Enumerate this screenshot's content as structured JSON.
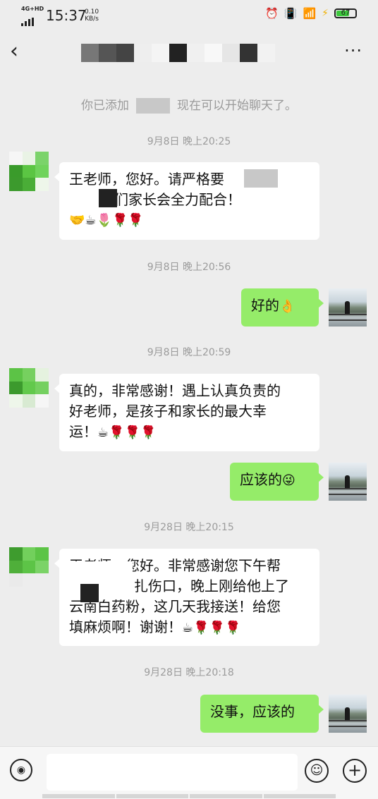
{
  "status_bar": {
    "network": "4G+HD",
    "time": "15:37",
    "speed_value": "0.10",
    "speed_unit": "KB/s",
    "battery": "67",
    "icons": [
      "alarm-icon",
      "vibrate-icon",
      "wifi-icon",
      "charging-icon",
      "battery-icon"
    ]
  },
  "header": {
    "back_icon": "‹",
    "more_icon": "···"
  },
  "system_message": {
    "before": "你已添加",
    "after": "现在可以开始聊天了。"
  },
  "messages": [
    {
      "timestamp": "9月8日 晚上20:25",
      "side": "left",
      "text": "王老师，您好。请严格要求  我们家长会全力配合！",
      "line1": "王老师，您好。请严格要",
      "line2": "我们家长会全力配合！",
      "emoji": "🤝☕🌷🌹🌹"
    },
    {
      "timestamp": "9月8日 晚上20:56",
      "side": "right",
      "text": "好的",
      "emoji": "👌"
    },
    {
      "timestamp": "9月8日 晚上20:59",
      "side": "left",
      "line1": "真的，非常感谢！遇上认真负责的",
      "line2": "好老师，是孩子和家长的最大幸",
      "line3": "运！",
      "emoji": "☕🌹🌹🌹"
    },
    {
      "timestamp": "",
      "side": "right",
      "text": "应该的",
      "emoji": "😜"
    },
    {
      "timestamp": "9月28日 晚上20:15",
      "side": "left",
      "line1": "王老师，您好。非常感谢您下午帮",
      "line2": "扎伤口，晚上刚给他上了",
      "line3": "云南白药粉，这几天我接送！给您",
      "line4": "填麻烦啊！谢谢！",
      "emoji": "☕🌹🌹🌹"
    },
    {
      "timestamp": "9月28日 晚上20:18",
      "side": "right",
      "text": "没事，应该的",
      "emoji": ""
    }
  ],
  "input_bar": {
    "voice_icon": "voice-icon",
    "emoji_icon": "emoji-icon",
    "plus_icon": "plus-icon",
    "text_value": ""
  },
  "colors": {
    "background": "#ededed",
    "bubble_self": "#95ec69",
    "bubble_other": "#ffffff",
    "timestamp": "#9b9b9b"
  }
}
